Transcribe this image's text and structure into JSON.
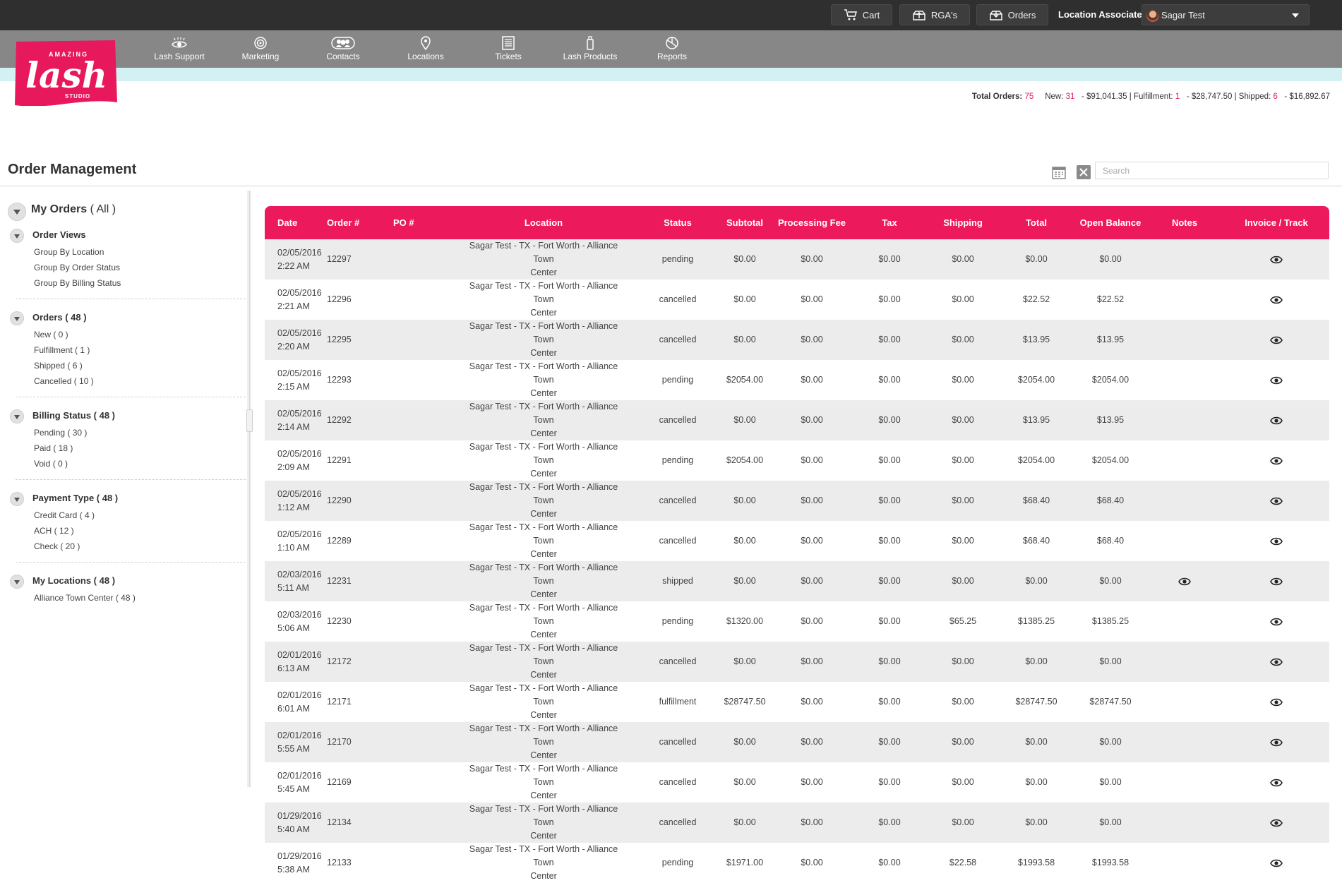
{
  "topbar": {
    "cart_label": "Cart",
    "rgas_label": "RGA's",
    "orders_label": "Orders",
    "associate_label": "Location Associate:",
    "associate_name": "Sagar Test"
  },
  "nav": {
    "items": [
      {
        "label": "Lash Support",
        "icon": "eye-icon"
      },
      {
        "label": "Marketing",
        "icon": "target-icon"
      },
      {
        "label": "Contacts",
        "icon": "contacts-icon"
      },
      {
        "label": "Locations",
        "icon": "map-pin-icon"
      },
      {
        "label": "Tickets",
        "icon": "ticket-icon"
      },
      {
        "label": "Lash Products",
        "icon": "product-icon"
      },
      {
        "label": "Reports",
        "icon": "chart-icon"
      }
    ]
  },
  "brand": {
    "top": "AMAZING",
    "name": "lash",
    "sub": "STUDIO",
    "color": "#e8185c"
  },
  "summary": {
    "total_label": "Total Orders:",
    "total_value": "75",
    "new_label": "New:",
    "new_value": "31",
    "new_amount": "- $91,041.35",
    "fulfillment_label": "Fulfillment:",
    "fulfillment_value": "1",
    "fulfillment_amount": "- $28,747.50",
    "shipped_label": "Shipped:",
    "shipped_value": "6",
    "shipped_amount": "- $16,892.67"
  },
  "page": {
    "title": "Order Management",
    "search_placeholder": "Search"
  },
  "sidebar": {
    "my_orders": "My Orders",
    "my_orders_filter": "( All )",
    "sections": [
      {
        "title": "Order Views",
        "items": [
          "Group By Location",
          "Group By Order Status",
          "Group By Billing Status"
        ]
      },
      {
        "title": "Orders ( 48 )",
        "items": [
          "New ( 0 )",
          "Fulfillment ( 1 )",
          "Shipped ( 6 )",
          "Cancelled ( 10 )"
        ]
      },
      {
        "title": "Billing Status ( 48 )",
        "items": [
          "Pending ( 30 )",
          "Paid ( 18 )",
          "Void ( 0 )"
        ]
      },
      {
        "title": "Payment Type ( 48 )",
        "items": [
          "Credit Card ( 4 )",
          "ACH ( 12 )",
          "Check ( 20 )"
        ]
      },
      {
        "title": "My Locations ( 48 )",
        "items": [
          "Alliance Town Center ( 48 )"
        ]
      }
    ]
  },
  "table": {
    "columns": [
      "Date",
      "Order #",
      "PO #",
      "Location",
      "Status",
      "Subtotal",
      "Processing Fee",
      "Tax",
      "Shipping",
      "Total",
      "Open Balance",
      "Notes",
      "Invoice / Track"
    ],
    "rows": [
      {
        "date": "02/05/2016",
        "time": "2:22 AM",
        "order": "12297",
        "po": "",
        "loc1": "Sagar Test - TX - Fort Worth - Alliance Town",
        "loc2": "Center",
        "status": "pending",
        "subtotal": "$0.00",
        "fee": "$0.00",
        "tax": "$0.00",
        "shipping": "$0.00",
        "total": "$0.00",
        "balance": "$0.00",
        "notes": false
      },
      {
        "date": "02/05/2016",
        "time": "2:21 AM",
        "order": "12296",
        "po": "",
        "loc1": "Sagar Test - TX - Fort Worth - Alliance Town",
        "loc2": "Center",
        "status": "cancelled",
        "subtotal": "$0.00",
        "fee": "$0.00",
        "tax": "$0.00",
        "shipping": "$0.00",
        "total": "$22.52",
        "balance": "$22.52",
        "notes": false
      },
      {
        "date": "02/05/2016",
        "time": "2:20 AM",
        "order": "12295",
        "po": "",
        "loc1": "Sagar Test - TX - Fort Worth - Alliance Town",
        "loc2": "Center",
        "status": "cancelled",
        "subtotal": "$0.00",
        "fee": "$0.00",
        "tax": "$0.00",
        "shipping": "$0.00",
        "total": "$13.95",
        "balance": "$13.95",
        "notes": false
      },
      {
        "date": "02/05/2016",
        "time": "2:15 AM",
        "order": "12293",
        "po": "",
        "loc1": "Sagar Test - TX - Fort Worth - Alliance Town",
        "loc2": "Center",
        "status": "pending",
        "subtotal": "$2054.00",
        "fee": "$0.00",
        "tax": "$0.00",
        "shipping": "$0.00",
        "total": "$2054.00",
        "balance": "$2054.00",
        "notes": false
      },
      {
        "date": "02/05/2016",
        "time": "2:14 AM",
        "order": "12292",
        "po": "",
        "loc1": "Sagar Test - TX - Fort Worth - Alliance Town",
        "loc2": "Center",
        "status": "cancelled",
        "subtotal": "$0.00",
        "fee": "$0.00",
        "tax": "$0.00",
        "shipping": "$0.00",
        "total": "$13.95",
        "balance": "$13.95",
        "notes": false
      },
      {
        "date": "02/05/2016",
        "time": "2:09 AM",
        "order": "12291",
        "po": "",
        "loc1": "Sagar Test - TX - Fort Worth - Alliance Town",
        "loc2": "Center",
        "status": "pending",
        "subtotal": "$2054.00",
        "fee": "$0.00",
        "tax": "$0.00",
        "shipping": "$0.00",
        "total": "$2054.00",
        "balance": "$2054.00",
        "notes": false
      },
      {
        "date": "02/05/2016",
        "time": "1:12 AM",
        "order": "12290",
        "po": "",
        "loc1": "Sagar Test - TX - Fort Worth - Alliance Town",
        "loc2": "Center",
        "status": "cancelled",
        "subtotal": "$0.00",
        "fee": "$0.00",
        "tax": "$0.00",
        "shipping": "$0.00",
        "total": "$68.40",
        "balance": "$68.40",
        "notes": false
      },
      {
        "date": "02/05/2016",
        "time": "1:10 AM",
        "order": "12289",
        "po": "",
        "loc1": "Sagar Test - TX - Fort Worth - Alliance Town",
        "loc2": "Center",
        "status": "cancelled",
        "subtotal": "$0.00",
        "fee": "$0.00",
        "tax": "$0.00",
        "shipping": "$0.00",
        "total": "$68.40",
        "balance": "$68.40",
        "notes": false
      },
      {
        "date": "02/03/2016",
        "time": "5:11 AM",
        "order": "12231",
        "po": "",
        "loc1": "Sagar Test - TX - Fort Worth - Alliance Town",
        "loc2": "Center",
        "status": "shipped",
        "subtotal": "$0.00",
        "fee": "$0.00",
        "tax": "$0.00",
        "shipping": "$0.00",
        "total": "$0.00",
        "balance": "$0.00",
        "notes": true
      },
      {
        "date": "02/03/2016",
        "time": "5:06 AM",
        "order": "12230",
        "po": "",
        "loc1": "Sagar Test - TX - Fort Worth - Alliance Town",
        "loc2": "Center",
        "status": "pending",
        "subtotal": "$1320.00",
        "fee": "$0.00",
        "tax": "$0.00",
        "shipping": "$65.25",
        "total": "$1385.25",
        "balance": "$1385.25",
        "notes": false
      },
      {
        "date": "02/01/2016",
        "time": "6:13 AM",
        "order": "12172",
        "po": "",
        "loc1": "Sagar Test - TX - Fort Worth - Alliance Town",
        "loc2": "Center",
        "status": "cancelled",
        "subtotal": "$0.00",
        "fee": "$0.00",
        "tax": "$0.00",
        "shipping": "$0.00",
        "total": "$0.00",
        "balance": "$0.00",
        "notes": false
      },
      {
        "date": "02/01/2016",
        "time": "6:01 AM",
        "order": "12171",
        "po": "",
        "loc1": "Sagar Test - TX - Fort Worth - Alliance Town",
        "loc2": "Center",
        "status": "fulfillment",
        "subtotal": "$28747.50",
        "fee": "$0.00",
        "tax": "$0.00",
        "shipping": "$0.00",
        "total": "$28747.50",
        "balance": "$28747.50",
        "notes": false
      },
      {
        "date": "02/01/2016",
        "time": "5:55 AM",
        "order": "12170",
        "po": "",
        "loc1": "Sagar Test - TX - Fort Worth - Alliance Town",
        "loc2": "Center",
        "status": "cancelled",
        "subtotal": "$0.00",
        "fee": "$0.00",
        "tax": "$0.00",
        "shipping": "$0.00",
        "total": "$0.00",
        "balance": "$0.00",
        "notes": false
      },
      {
        "date": "02/01/2016",
        "time": "5:45 AM",
        "order": "12169",
        "po": "",
        "loc1": "Sagar Test - TX - Fort Worth - Alliance Town",
        "loc2": "Center",
        "status": "cancelled",
        "subtotal": "$0.00",
        "fee": "$0.00",
        "tax": "$0.00",
        "shipping": "$0.00",
        "total": "$0.00",
        "balance": "$0.00",
        "notes": false
      },
      {
        "date": "01/29/2016",
        "time": "5:40 AM",
        "order": "12134",
        "po": "",
        "loc1": "Sagar Test - TX - Fort Worth - Alliance Town",
        "loc2": "Center",
        "status": "cancelled",
        "subtotal": "$0.00",
        "fee": "$0.00",
        "tax": "$0.00",
        "shipping": "$0.00",
        "total": "$0.00",
        "balance": "$0.00",
        "notes": false
      },
      {
        "date": "01/29/2016",
        "time": "5:38 AM",
        "order": "12133",
        "po": "",
        "loc1": "Sagar Test - TX - Fort Worth - Alliance Town",
        "loc2": "Center",
        "status": "pending",
        "subtotal": "$1971.00",
        "fee": "$0.00",
        "tax": "$0.00",
        "shipping": "$22.58",
        "total": "$1993.58",
        "balance": "$1993.58",
        "notes": false
      }
    ]
  }
}
